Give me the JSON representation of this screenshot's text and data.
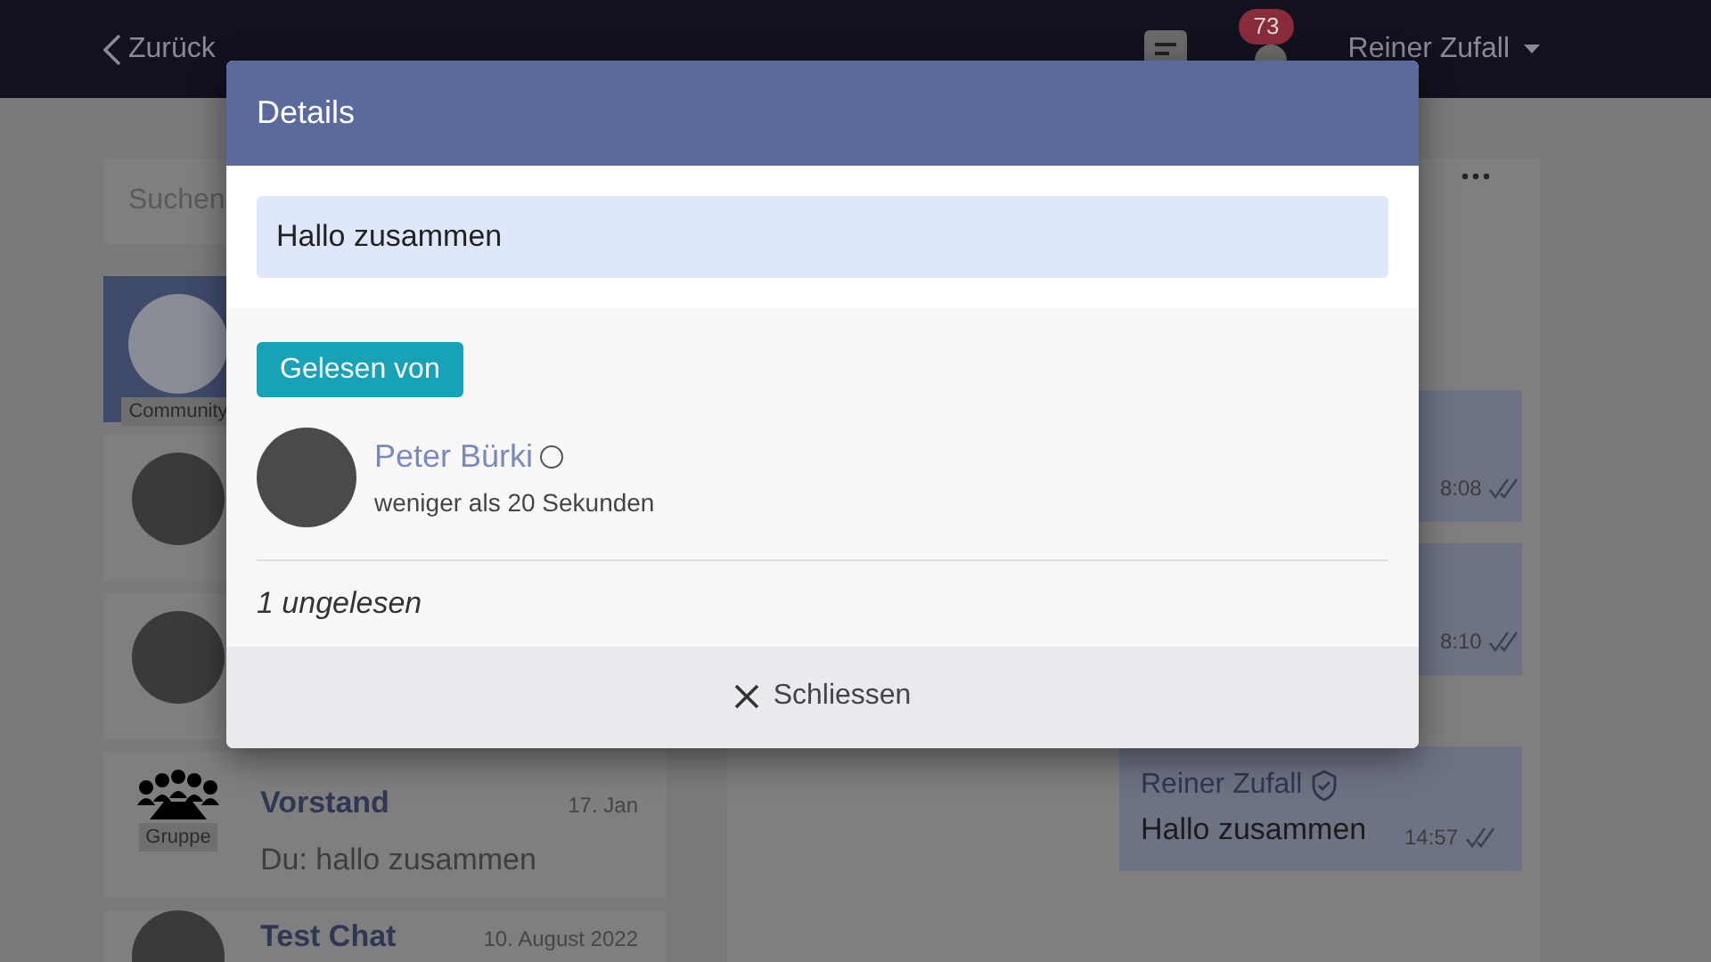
{
  "top_bar": {
    "back": "Zurück",
    "notification_count": "73",
    "user": "Reiner Zufall"
  },
  "sidebar": {
    "search": {
      "placeholder": "Suchen"
    },
    "items": [
      {
        "kind": "community",
        "tag": "Community",
        "selected": true
      },
      {
        "kind": "person",
        "selected": false
      },
      {
        "kind": "person",
        "selected": false
      },
      {
        "kind": "group",
        "tag": "Gruppe",
        "name": "Vorstand",
        "date": "17. Jan",
        "preview": "Du: hallo zusammen",
        "selected": false
      },
      {
        "kind": "person",
        "name": "Test Chat",
        "date": "10. August 2022",
        "selected": false
      }
    ]
  },
  "chat": {
    "messages": [
      {
        "time": "8:08",
        "read": true
      },
      {
        "time": "8:10",
        "read": true
      },
      {
        "sender": "Reiner Zufall",
        "verified": true,
        "text": "Hallo zusammen",
        "time": "14:57",
        "read": true
      }
    ]
  },
  "dialog": {
    "title": "Details",
    "message": "Hallo zusammen",
    "read_by_label": "Gelesen von",
    "readers": [
      {
        "name": "Peter Bürki",
        "online": false,
        "time": "weniger als 20 Sekunden"
      }
    ],
    "unread": "1 ungelesen",
    "close": "Schliessen"
  }
}
